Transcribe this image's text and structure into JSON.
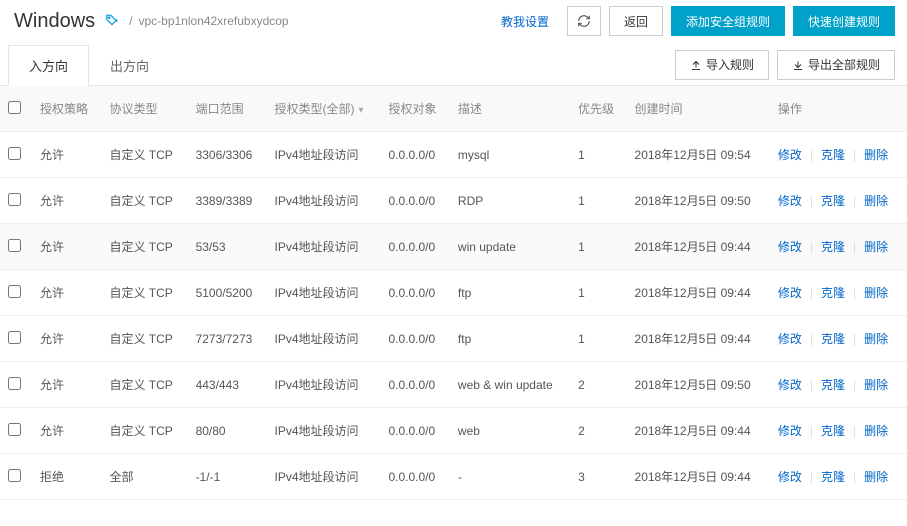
{
  "header": {
    "title": "Windows",
    "crumb": "vpc-bp1nlon42xrefubxydcop",
    "teach_link": "教我设置",
    "back_btn": "返回",
    "add_rule_btn": "添加安全组规则",
    "quick_create_btn": "快速创建规则"
  },
  "tabs": {
    "in": "入方向",
    "out": "出方向",
    "import_btn": "导入规则",
    "export_btn": "导出全部规则"
  },
  "columns": {
    "policy": "授权策略",
    "protocol": "协议类型",
    "port": "端口范围",
    "authtype": "授权类型(全部)",
    "object": "授权对象",
    "desc": "描述",
    "priority": "优先级",
    "created": "创建时间",
    "ops": "操作"
  },
  "ops": {
    "modify": "修改",
    "clone": "克隆",
    "delete": "删除"
  },
  "rows": [
    {
      "policy": "允许",
      "protocol": "自定义 TCP",
      "port": "3306/3306",
      "authtype": "IPv4地址段访问",
      "object": "0.0.0.0/0",
      "desc": "mysql",
      "priority": "1",
      "created": "2018年12月5日 09:54"
    },
    {
      "policy": "允许",
      "protocol": "自定义 TCP",
      "port": "3389/3389",
      "authtype": "IPv4地址段访问",
      "object": "0.0.0.0/0",
      "desc": "RDP",
      "priority": "1",
      "created": "2018年12月5日 09:50"
    },
    {
      "policy": "允许",
      "protocol": "自定义 TCP",
      "port": "53/53",
      "authtype": "IPv4地址段访问",
      "object": "0.0.0.0/0",
      "desc": "win update",
      "priority": "1",
      "created": "2018年12月5日 09:44"
    },
    {
      "policy": "允许",
      "protocol": "自定义 TCP",
      "port": "5100/5200",
      "authtype": "IPv4地址段访问",
      "object": "0.0.0.0/0",
      "desc": "ftp",
      "priority": "1",
      "created": "2018年12月5日 09:44"
    },
    {
      "policy": "允许",
      "protocol": "自定义 TCP",
      "port": "7273/7273",
      "authtype": "IPv4地址段访问",
      "object": "0.0.0.0/0",
      "desc": "ftp",
      "priority": "1",
      "created": "2018年12月5日 09:44"
    },
    {
      "policy": "允许",
      "protocol": "自定义 TCP",
      "port": "443/443",
      "authtype": "IPv4地址段访问",
      "object": "0.0.0.0/0",
      "desc": "web & win update",
      "priority": "2",
      "created": "2018年12月5日 09:50"
    },
    {
      "policy": "允许",
      "protocol": "自定义 TCP",
      "port": "80/80",
      "authtype": "IPv4地址段访问",
      "object": "0.0.0.0/0",
      "desc": "web",
      "priority": "2",
      "created": "2018年12月5日 09:44"
    },
    {
      "policy": "拒绝",
      "protocol": "全部",
      "port": "-1/-1",
      "authtype": "IPv4地址段访问",
      "object": "0.0.0.0/0",
      "desc": "-",
      "priority": "3",
      "created": "2018年12月5日 09:44"
    }
  ]
}
